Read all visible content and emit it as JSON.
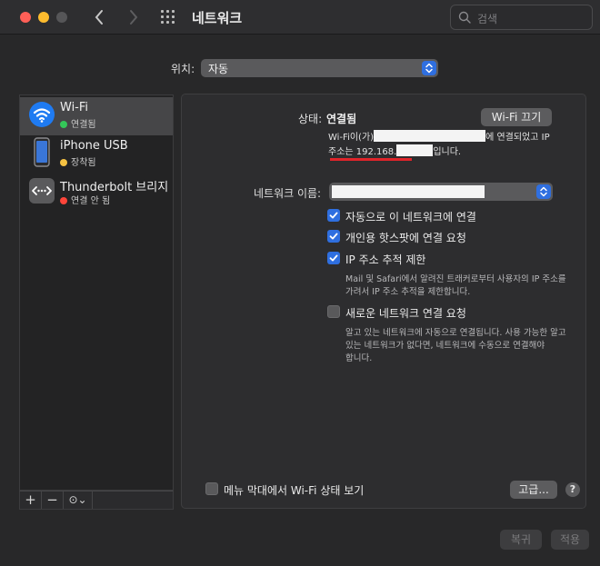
{
  "window": {
    "title": "네트워크"
  },
  "search": {
    "placeholder": "검색"
  },
  "location": {
    "label": "위치:",
    "value": "자동"
  },
  "services": [
    {
      "name": "Wi-Fi",
      "status": "연결됨",
      "status_color": "#34c759",
      "icon": "wifi-icon",
      "selected": true
    },
    {
      "name": "iPhone USB",
      "status": "장착됨",
      "status_color": "#f5c242",
      "icon": "iphone-icon"
    },
    {
      "name": "Thunderbolt 브리지",
      "status": "연결 안 됨",
      "status_color": "#ff453a",
      "icon": "thunderbolt-bridge-icon"
    }
  ],
  "sidebar_footer": {
    "add": "+",
    "remove": "−",
    "more": "⊙⌄"
  },
  "status": {
    "label": "상태:",
    "value": "연결됨",
    "turn_off_button": "Wi-Fi 끄기",
    "desc_line1_prefix": "Wi-Fi이(가)",
    "desc_line1_suffix": "에 연결되었고 IP",
    "desc_line2_prefix": "주소는 ",
    "ip_prefix": "192.168.",
    "desc_line2_suffix": "입니다."
  },
  "network_name": {
    "label": "네트워크 이름:"
  },
  "options": [
    {
      "label": "자동으로 이 네트워크에 연결",
      "checked": true
    },
    {
      "label": "개인용 핫스팟에 연결 요청",
      "checked": true
    },
    {
      "label": "IP 주소 추적 제한",
      "checked": true
    },
    {
      "label": "새로운 네트워크 연결 요청",
      "checked": false
    }
  ],
  "ip_tracking_desc": [
    "Mail 및 Safari에서 알려진 트래커로부터 사용자의 IP 주소를",
    "가려서 IP 주소 추적을 제한합니다."
  ],
  "new_network_desc": [
    "알고 있는 네트워크에 자동으로 연결됩니다. 사용 가능한 알고",
    "있는 네트워크가 없다면, 네트워크에 수동으로 연결해야",
    "합니다."
  ],
  "menubar_option": {
    "label": "메뉴 막대에서 Wi-Fi 상태 보기",
    "checked": false
  },
  "advanced_button": "고급...",
  "help_button": "?",
  "revert_button": "복귀",
  "apply_button": "적용"
}
